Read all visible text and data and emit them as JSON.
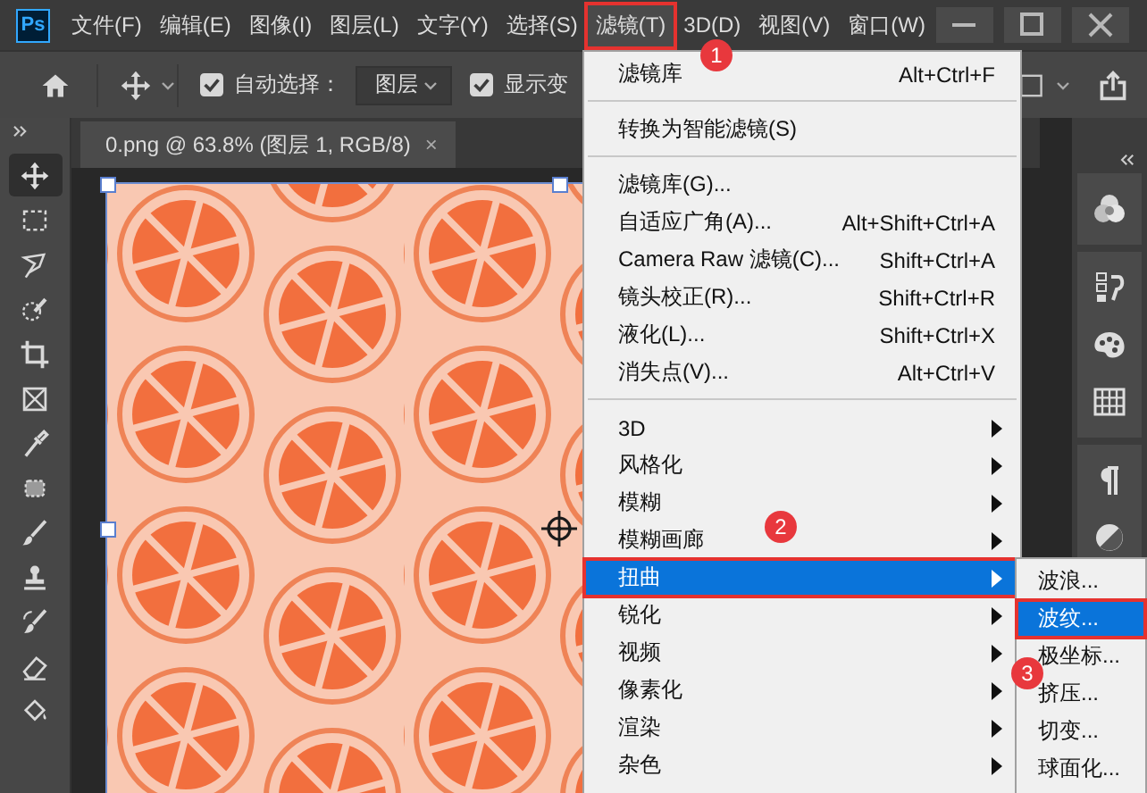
{
  "app": {
    "logo": "Ps"
  },
  "menubar": {
    "items": [
      {
        "label": "文件(F)",
        "selected": false,
        "outlined": false
      },
      {
        "label": "编辑(E)",
        "selected": false,
        "outlined": false
      },
      {
        "label": "图像(I)",
        "selected": false,
        "outlined": false
      },
      {
        "label": "图层(L)",
        "selected": false,
        "outlined": false
      },
      {
        "label": "文字(Y)",
        "selected": false,
        "outlined": false
      },
      {
        "label": "选择(S)",
        "selected": false,
        "outlined": false
      },
      {
        "label": "滤镜(T)",
        "selected": true,
        "outlined": true
      },
      {
        "label": "3D(D)",
        "selected": false,
        "outlined": false
      },
      {
        "label": "视图(V)",
        "selected": false,
        "outlined": false
      },
      {
        "label": "窗口(W)",
        "selected": false,
        "outlined": false
      }
    ]
  },
  "options_bar": {
    "auto_select": {
      "label": "自动选择：",
      "checked": true
    },
    "layer_dropdown": {
      "value": "图层"
    },
    "show_transform": {
      "label": "显示变",
      "checked": true
    }
  },
  "document_tab": {
    "title": "0.png @ 63.8% (图层 1, RGB/8)",
    "close": "×"
  },
  "filter_menu": {
    "items": [
      {
        "kind": "command",
        "label": "滤镜库",
        "shortcut": "Alt+Ctrl+F",
        "selected": false,
        "outlined": false
      },
      {
        "kind": "separator"
      },
      {
        "kind": "command",
        "label": "转换为智能滤镜(S)",
        "selected": false,
        "outlined": false
      },
      {
        "kind": "separator"
      },
      {
        "kind": "command",
        "label": "滤镜库(G)...",
        "selected": false,
        "outlined": false
      },
      {
        "kind": "command",
        "label": "自适应广角(A)...",
        "shortcut": "Alt+Shift+Ctrl+A",
        "selected": false,
        "outlined": false
      },
      {
        "kind": "command",
        "label": "Camera Raw 滤镜(C)...",
        "shortcut": "Shift+Ctrl+A",
        "selected": false,
        "outlined": false
      },
      {
        "kind": "command",
        "label": "镜头校正(R)...",
        "shortcut": "Shift+Ctrl+R",
        "selected": false,
        "outlined": false
      },
      {
        "kind": "command",
        "label": "液化(L)...",
        "shortcut": "Shift+Ctrl+X",
        "selected": false,
        "outlined": false
      },
      {
        "kind": "command",
        "label": "消失点(V)...",
        "shortcut": "Alt+Ctrl+V",
        "selected": false,
        "outlined": false
      },
      {
        "kind": "separator"
      },
      {
        "kind": "submenu",
        "label": "3D",
        "selected": false,
        "outlined": false
      },
      {
        "kind": "submenu",
        "label": "风格化",
        "selected": false,
        "outlined": false
      },
      {
        "kind": "submenu",
        "label": "模糊",
        "selected": false,
        "outlined": false
      },
      {
        "kind": "submenu",
        "label": "模糊画廊",
        "selected": false,
        "outlined": false
      },
      {
        "kind": "submenu",
        "label": "扭曲",
        "selected": true,
        "outlined": true
      },
      {
        "kind": "submenu",
        "label": "锐化",
        "selected": false,
        "outlined": false
      },
      {
        "kind": "submenu",
        "label": "视频",
        "selected": false,
        "outlined": false
      },
      {
        "kind": "submenu",
        "label": "像素化",
        "selected": false,
        "outlined": false
      },
      {
        "kind": "submenu",
        "label": "渲染",
        "selected": false,
        "outlined": false
      },
      {
        "kind": "submenu",
        "label": "杂色",
        "selected": false,
        "outlined": false
      }
    ]
  },
  "distort_submenu": {
    "items": [
      {
        "kind": "command",
        "label": "波浪...",
        "selected": false,
        "outlined": false
      },
      {
        "kind": "command",
        "label": "波纹...",
        "selected": true,
        "outlined": true
      },
      {
        "kind": "command",
        "label": "极坐标...",
        "selected": false,
        "outlined": false
      },
      {
        "kind": "command",
        "label": "挤压...",
        "selected": false,
        "outlined": false
      },
      {
        "kind": "command",
        "label": "切变...",
        "selected": false,
        "outlined": false
      },
      {
        "kind": "command",
        "label": "球面化...",
        "selected": false,
        "outlined": false
      }
    ]
  },
  "step_badges": [
    {
      "label": "1"
    },
    {
      "label": "2"
    },
    {
      "label": "3"
    }
  ]
}
